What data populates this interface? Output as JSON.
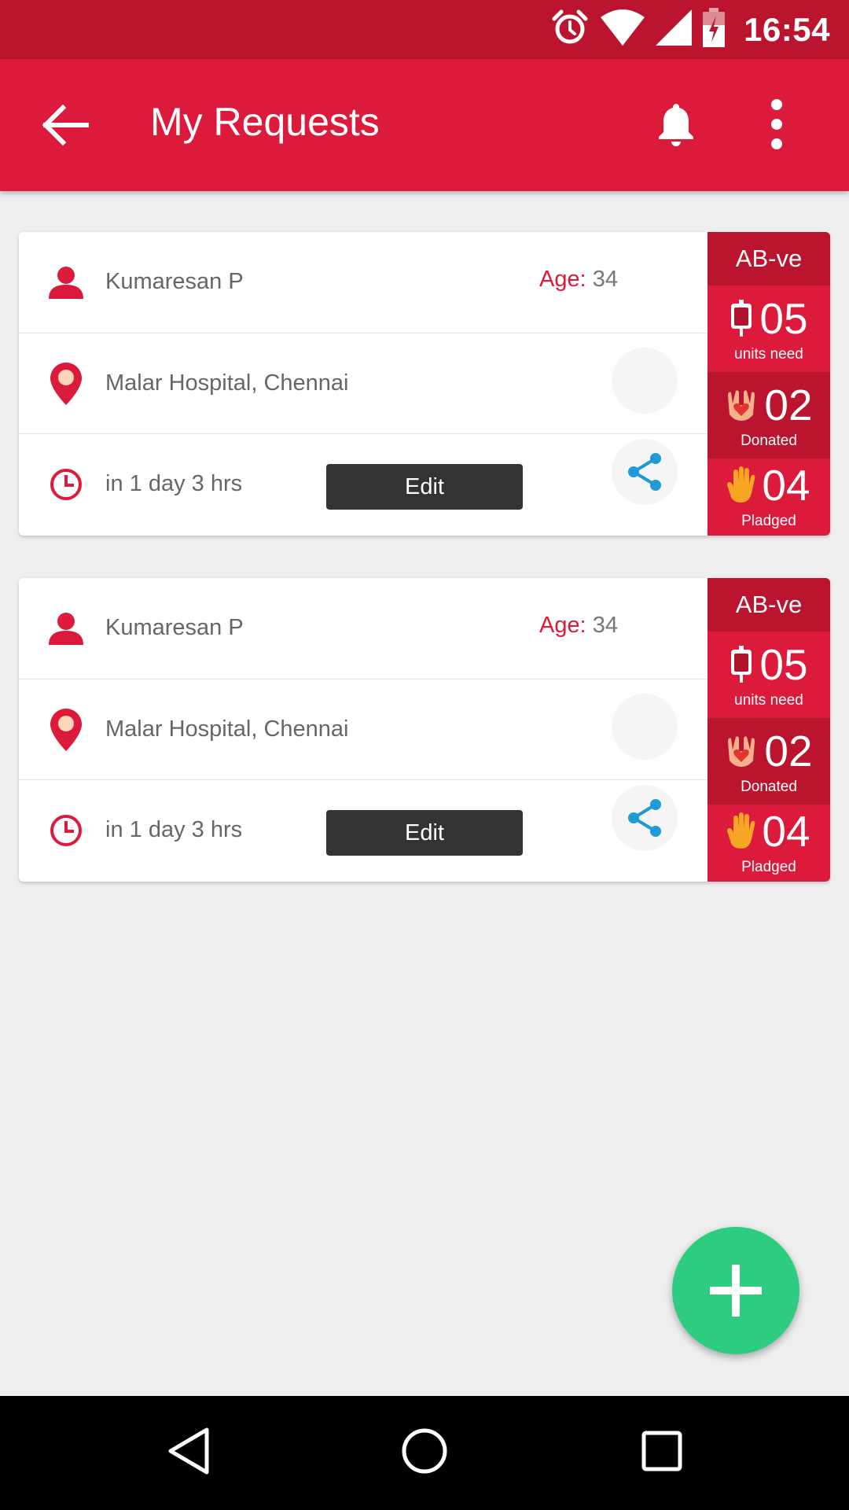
{
  "status_bar": {
    "time": "16:54",
    "icons": [
      "alarm-icon",
      "wifi-icon",
      "signal-icon",
      "battery-charging-icon"
    ]
  },
  "app_bar": {
    "title": "My Requests",
    "icons": [
      "back-arrow-icon",
      "bell-icon",
      "more-vert-icon"
    ]
  },
  "requests": [
    {
      "name": "Kumaresan P",
      "age_label": "Age:",
      "age": "34",
      "location": "Malar Hospital, Chennai",
      "time": "in 1 day 3 hrs",
      "edit_label": "Edit",
      "blood_type": "AB-ve",
      "units_need": "05",
      "units_need_label": "units need",
      "donated": "02",
      "donated_label": "Donated",
      "pledged": "04",
      "pledged_label": "Pladged"
    },
    {
      "name": "Kumaresan P",
      "age_label": "Age:",
      "age": "34",
      "location": "Malar Hospital, Chennai",
      "time": "in 1 day 3 hrs",
      "edit_label": "Edit",
      "blood_type": "AB-ve",
      "units_need": "05",
      "units_need_label": "units need",
      "donated": "02",
      "donated_label": "Donated",
      "pledged": "04",
      "pledged_label": "Pladged"
    }
  ],
  "fab": {
    "icon": "plus-icon",
    "color": "#2ecc7f"
  },
  "nav_bar": {
    "icons": [
      "nav-back-icon",
      "nav-home-icon",
      "nav-recents-icon"
    ]
  },
  "colors": {
    "primary": "#dc1a3b",
    "primary_dark": "#bb142f",
    "accent": "#2ecc7f",
    "share": "#1e9ad6"
  }
}
